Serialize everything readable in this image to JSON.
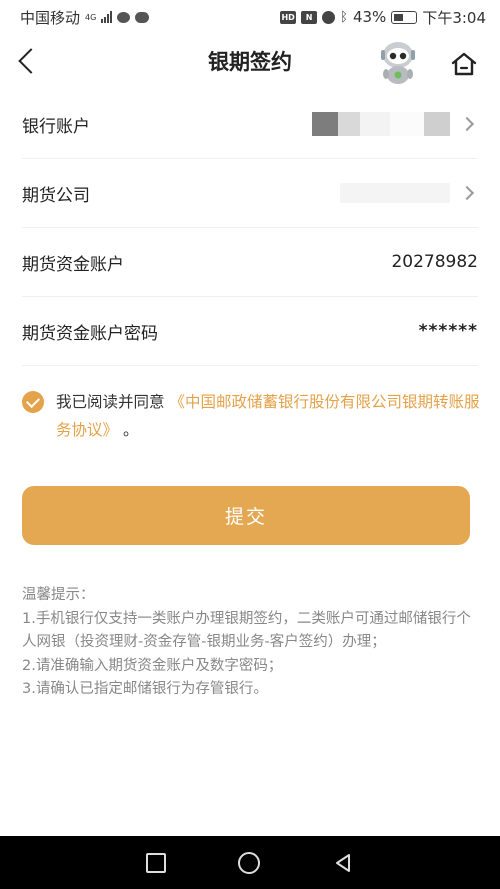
{
  "status_bar": {
    "carrier": "中国移动",
    "network": "4G",
    "nfc_label": "N",
    "hd_label": "HD",
    "battery": "43%",
    "time": "下午3:04"
  },
  "header": {
    "title": "银期签约"
  },
  "form": {
    "bank_account_label": "银行账户",
    "futures_company_label": "期货公司",
    "futures_account_label": "期货资金账户",
    "futures_account_value": "20278982",
    "password_label": "期货资金账户密码",
    "password_value": "******"
  },
  "agreement": {
    "prefix": "我已阅读并同意",
    "link": "《中国邮政储蓄银行股份有限公司银期转账服务协议》",
    "suffix": "。"
  },
  "submit_label": "提交",
  "tips": {
    "title": "温馨提示：",
    "items": [
      "1.手机银行仅支持一类账户办理银期签约，二类账户可通过邮储银行个人网银（投资理财-资金存管-银期业务-客户签约）办理；",
      "2.请准确输入期货资金账户及数字密码；",
      "3.请确认已指定邮储银行为存管银行。"
    ]
  },
  "colors": {
    "accent": "#e4a853",
    "link": "#e4a24a",
    "tips_text": "#888888"
  },
  "icons": {
    "back": "back-arrow-icon",
    "robot": "robot-assistant-icon",
    "home": "home-icon",
    "chevron": "chevron-right-icon",
    "check": "checkbox-checked-icon"
  }
}
